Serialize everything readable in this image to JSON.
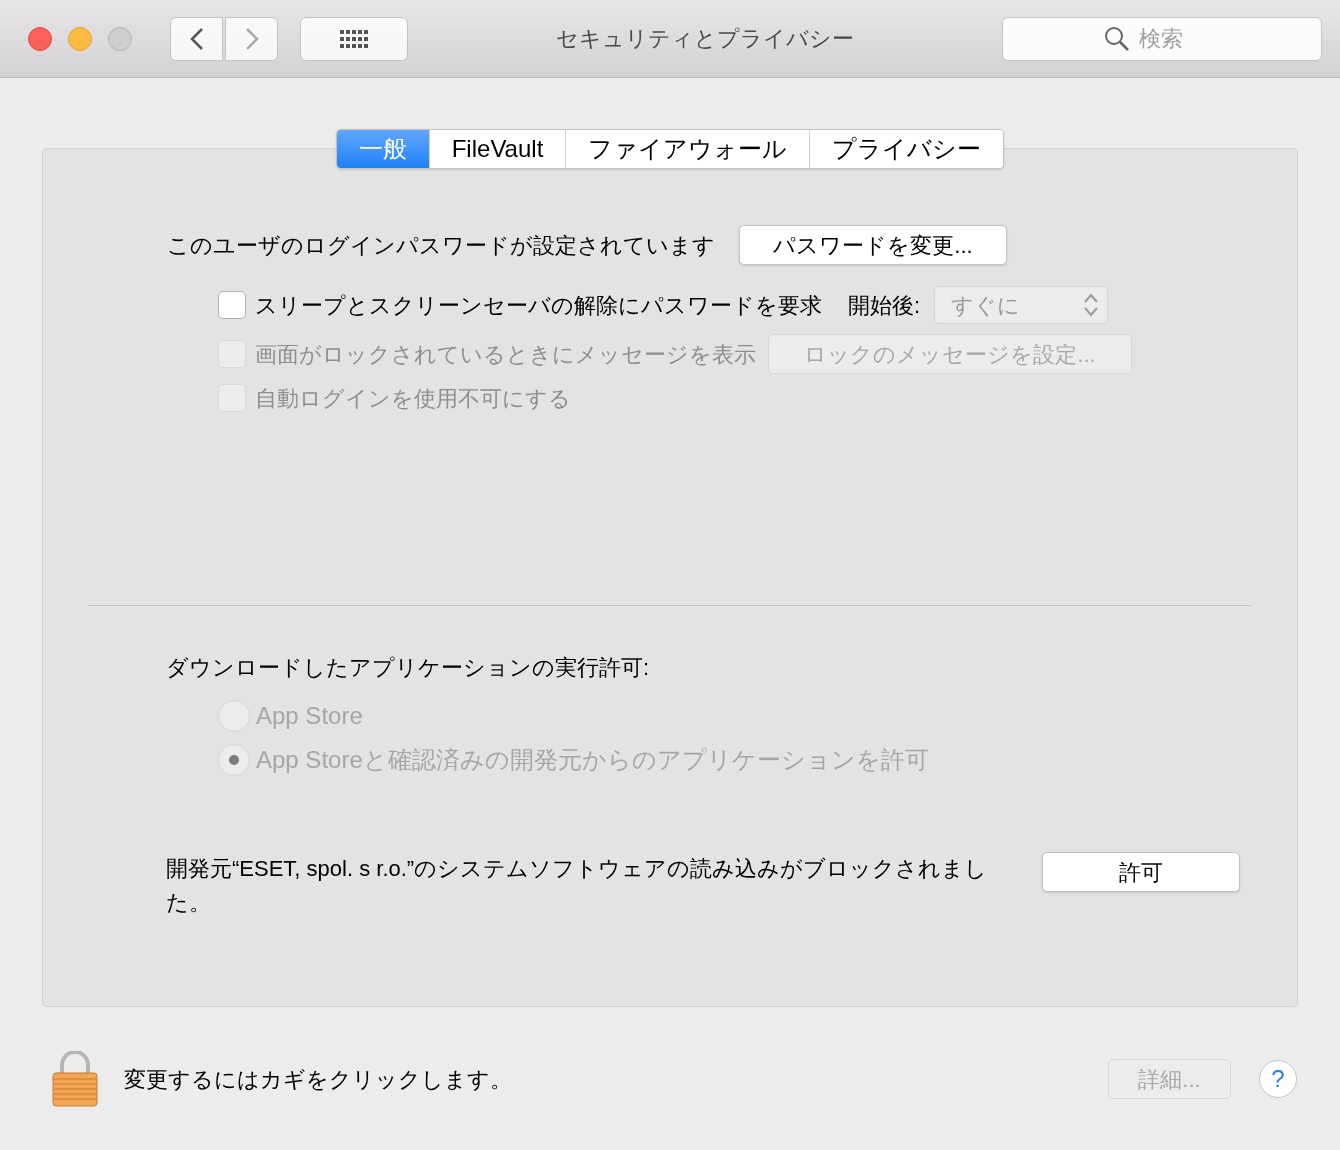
{
  "window": {
    "title": "セキュリティとプライバシー",
    "search": {
      "placeholder": "検索"
    }
  },
  "tabs": [
    {
      "label": "一般",
      "selected": true
    },
    {
      "label": "FileVault",
      "selected": false
    },
    {
      "label": "ファイアウォール",
      "selected": false
    },
    {
      "label": "プライバシー",
      "selected": false
    }
  ],
  "password": {
    "text": "このユーザのログインパスワードが設定されています",
    "button": "パスワードを変更..."
  },
  "options": [
    {
      "kind": "delay",
      "label": "スリープとスクリーンセーバの解除にパスワードを要求",
      "checked": false,
      "disabled": false,
      "after_label": "開始後:",
      "value": "すぐに"
    },
    {
      "kind": "button",
      "label": "画面がロックされているときにメッセージを表示",
      "checked": false,
      "disabled": true,
      "button": "ロックのメッセージを設定...",
      "button_disabled": true
    },
    {
      "kind": "plain",
      "label": "自動ログインを使用不可にする",
      "checked": false,
      "disabled": true
    }
  ],
  "downloads": {
    "label": "ダウンロードしたアプリケーションの実行許可:",
    "choices": [
      {
        "label": "App Store",
        "selected": false,
        "disabled": true
      },
      {
        "label": "App Storeと確認済みの開発元からのアプリケーションを許可",
        "selected": true,
        "disabled": true
      }
    ]
  },
  "blocked": {
    "text": "開発元“ESET, spol. s r.o.”のシステムソフトウェアの読み込みがブロックされました。",
    "button": "許可"
  },
  "footer": {
    "lock_text": "変更するにはカギをクリックします。",
    "details_button": "詳細...",
    "details_disabled": true,
    "help": "?"
  }
}
